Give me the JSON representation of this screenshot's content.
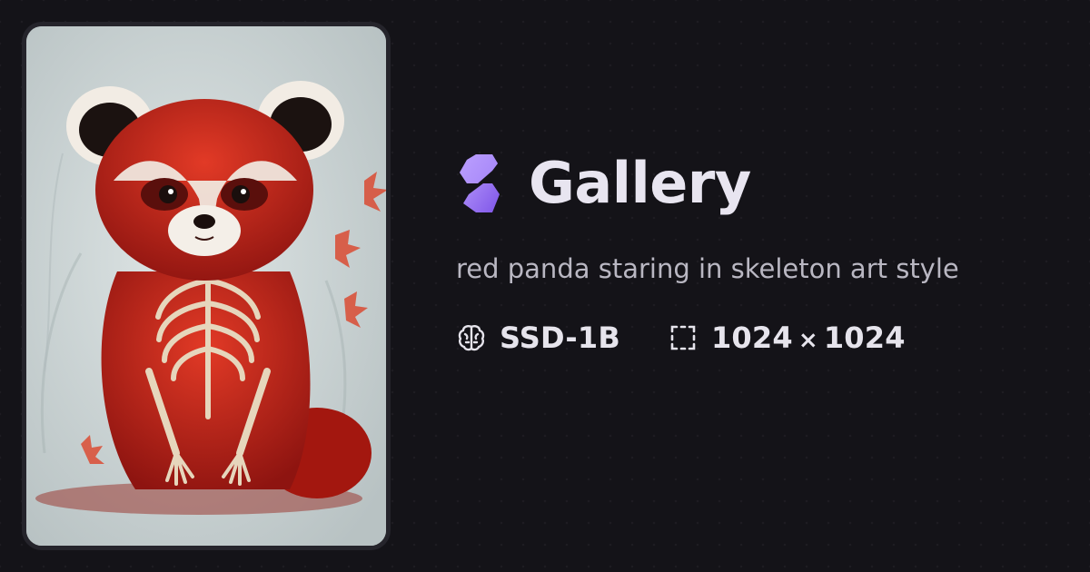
{
  "header": {
    "logo_icon": "gallery-logo-icon",
    "title": "Gallery"
  },
  "prompt": "red panda staring in skeleton art style",
  "meta": {
    "model_icon": "brain-icon",
    "model": "SSD-1B",
    "size_icon": "dashed-square-icon",
    "width": "1024",
    "times": "×",
    "height": "1024"
  },
  "colors": {
    "background": "#141318",
    "accent": "#9f7bf2",
    "text_primary": "#e8e5f0",
    "text_secondary": "#b9b7c2"
  }
}
